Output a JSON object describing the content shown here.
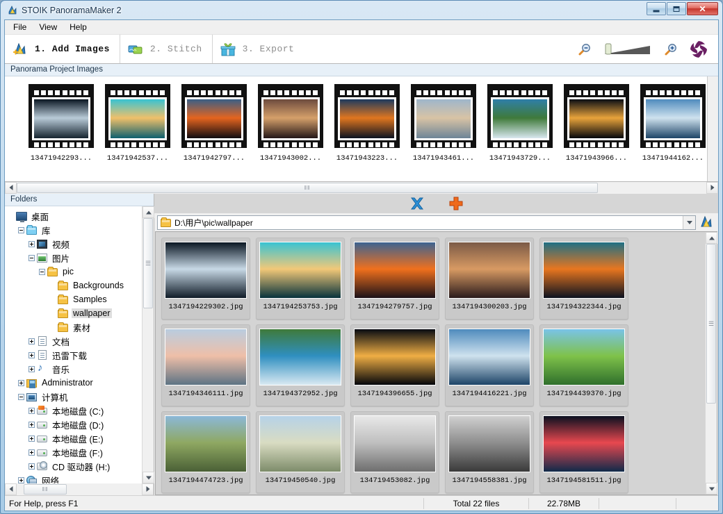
{
  "window": {
    "title": "STOIK PanoramaMaker 2",
    "icon": "app-icon",
    "buttons": {
      "minimize": "–",
      "maximize": "□",
      "close": "✕"
    }
  },
  "menu": {
    "items": [
      "File",
      "View",
      "Help"
    ]
  },
  "steps": [
    {
      "label": "1. Add Images",
      "icon": "add-images-icon",
      "active": true
    },
    {
      "label": "2. Stitch",
      "icon": "stitch-icon",
      "active": false
    },
    {
      "label": "3. Export",
      "icon": "export-gift-icon",
      "active": false
    }
  ],
  "zoom_tools": {
    "zoom_out": "zoom-out-icon",
    "slider": "zoom-slider",
    "zoom_in": "zoom-in-icon",
    "logo": "stoik-swirl-logo"
  },
  "filmstrip": {
    "header": "Panorama Project Images",
    "items": [
      {
        "caption": "13471942293...",
        "c1": "#0a1622",
        "c2": "#b9cbd8",
        "c3": "#16242f"
      },
      {
        "caption": "13471942537...",
        "c1": "#39c3d2",
        "c2": "#f0c06a",
        "c3": "#0d5f6e"
      },
      {
        "caption": "13471942797...",
        "c1": "#3a5f86",
        "c2": "#e4641f",
        "c3": "#100b10"
      },
      {
        "caption": "13471943002...",
        "c1": "#6d4b3e",
        "c2": "#d5a06a",
        "c3": "#241718"
      },
      {
        "caption": "13471943223...",
        "c1": "#1d3a5e",
        "c2": "#e0761f",
        "c3": "#0b1220"
      },
      {
        "caption": "13471943461...",
        "c1": "#9fb6cb",
        "c2": "#d8c3a5",
        "c3": "#6d8497"
      },
      {
        "caption": "13471943729...",
        "c1": "#2f7fa8",
        "c2": "#3f7a3a",
        "c3": "#d8e7ef"
      },
      {
        "caption": "13471943966...",
        "c1": "#0a0d14",
        "c2": "#e8a33b",
        "c3": "#05070c"
      },
      {
        "caption": "13471944162...",
        "c1": "#4f8bbd",
        "c2": "#cfe2ee",
        "c3": "#1d4467"
      }
    ],
    "scroll_thumb_grip": "‖‖"
  },
  "tree": {
    "header": "Folders",
    "nodes": [
      {
        "label": "桌面",
        "indent": 0,
        "expander": "none",
        "icon": "desktop-icon",
        "selected": false
      },
      {
        "label": "库",
        "indent": 1,
        "expander": "minus",
        "icon": "library-folder-icon",
        "selected": false
      },
      {
        "label": "视频",
        "indent": 2,
        "expander": "plus",
        "icon": "videos-icon",
        "selected": false
      },
      {
        "label": "图片",
        "indent": 2,
        "expander": "minus",
        "icon": "pictures-icon",
        "selected": false
      },
      {
        "label": "pic",
        "indent": 3,
        "expander": "minus",
        "icon": "folder-icon",
        "selected": false
      },
      {
        "label": "Backgrounds",
        "indent": 4,
        "expander": "none",
        "icon": "folder-icon",
        "selected": false
      },
      {
        "label": "Samples",
        "indent": 4,
        "expander": "none",
        "icon": "folder-icon",
        "selected": false
      },
      {
        "label": "wallpaper",
        "indent": 4,
        "expander": "none",
        "icon": "folder-icon",
        "selected": true
      },
      {
        "label": "素材",
        "indent": 4,
        "expander": "none",
        "icon": "folder-icon",
        "selected": false
      },
      {
        "label": "文档",
        "indent": 2,
        "expander": "plus",
        "icon": "documents-icon",
        "selected": false
      },
      {
        "label": "迅雷下载",
        "indent": 2,
        "expander": "plus",
        "icon": "thunder-download-icon",
        "selected": false
      },
      {
        "label": "音乐",
        "indent": 2,
        "expander": "plus",
        "icon": "music-icon",
        "selected": false
      },
      {
        "label": "Administrator",
        "indent": 1,
        "expander": "plus",
        "icon": "user-folder-icon",
        "selected": false
      },
      {
        "label": "计算机",
        "indent": 1,
        "expander": "minus",
        "icon": "computer-icon",
        "selected": false
      },
      {
        "label": "本地磁盘 (C:)",
        "indent": 2,
        "expander": "plus",
        "icon": "system-drive-icon",
        "selected": false
      },
      {
        "label": "本地磁盘 (D:)",
        "indent": 2,
        "expander": "plus",
        "icon": "drive-icon",
        "selected": false
      },
      {
        "label": "本地磁盘 (E:)",
        "indent": 2,
        "expander": "plus",
        "icon": "drive-icon",
        "selected": false
      },
      {
        "label": "本地磁盘 (F:)",
        "indent": 2,
        "expander": "plus",
        "icon": "drive-icon",
        "selected": false
      },
      {
        "label": "CD 驱动器 (H:)",
        "indent": 2,
        "expander": "plus",
        "icon": "cd-drive-icon",
        "selected": false
      },
      {
        "label": "网络",
        "indent": 1,
        "expander": "plus",
        "icon": "network-icon",
        "selected": false
      }
    ],
    "hscroll_grip": "‖‖"
  },
  "browser": {
    "toolbar": {
      "remove_icon": "blue-x-remove-icon",
      "add_icon": "orange-plus-add-icon"
    },
    "path": "D:\\用户\\pic\\wallpaper",
    "path_folder_icon": "folder-icon",
    "dropdown_icon": "chevron-down-icon",
    "go_icon": "add-to-project-icon",
    "files": [
      {
        "name": "1347194229302.jpg",
        "c1": "#0a1622",
        "c2": "#c8d9e6",
        "c3": "#101c28"
      },
      {
        "name": "1347194253753.jpg",
        "c1": "#39c3d2",
        "c2": "#f2c878",
        "c3": "#07323c"
      },
      {
        "name": "1347194279757.jpg",
        "c1": "#3c6390",
        "c2": "#f0701d",
        "c3": "#1b1118"
      },
      {
        "name": "1347194300203.jpg",
        "c1": "#7b5a46",
        "c2": "#d89a63",
        "c3": "#2a1b1c"
      },
      {
        "name": "1347194322344.jpg",
        "c1": "#1f6f84",
        "c2": "#e8761f",
        "c3": "#0c1220"
      },
      {
        "name": "1347194346111.jpg",
        "c1": "#b9cde0",
        "c2": "#efbfa8",
        "c3": "#5d7384"
      },
      {
        "name": "1347194372952.jpg",
        "c1": "#3f7a3a",
        "c2": "#2f8fc0",
        "c3": "#d9e9f2"
      },
      {
        "name": "1347194396655.jpg",
        "c1": "#080b12",
        "c2": "#efae44",
        "c3": "#04060b"
      },
      {
        "name": "1347194416221.jpg",
        "c1": "#4f8bbd",
        "c2": "#cfe2ee",
        "c3": "#1d4467"
      },
      {
        "name": "1347194439370.jpg",
        "c1": "#79c3e8",
        "c2": "#7fc24a",
        "c3": "#2f6f2c"
      },
      {
        "name": "1347194474723.jpg",
        "c1": "#8bb8d8",
        "c2": "#8fa862",
        "c3": "#4a6036"
      },
      {
        "name": "134719450540.jpg",
        "c1": "#b6d2e8",
        "c2": "#d9dcc2",
        "c3": "#7d8c6a"
      },
      {
        "name": "134719453082.jpg",
        "c1": "#e8e8e8",
        "c2": "#bfbfbf",
        "c3": "#6e6e6e"
      },
      {
        "name": "1347194558381.jpg",
        "c1": "#d0d0d0",
        "c2": "#8e8e8e",
        "c3": "#3a3a3a"
      },
      {
        "name": "1347194581511.jpg",
        "c1": "#0a1020",
        "c2": "#e8484f",
        "c3": "#102a4a"
      }
    ]
  },
  "statusbar": {
    "help": "For Help, press F1",
    "total_files": "Total 22 files",
    "total_size": "22.78MB"
  }
}
